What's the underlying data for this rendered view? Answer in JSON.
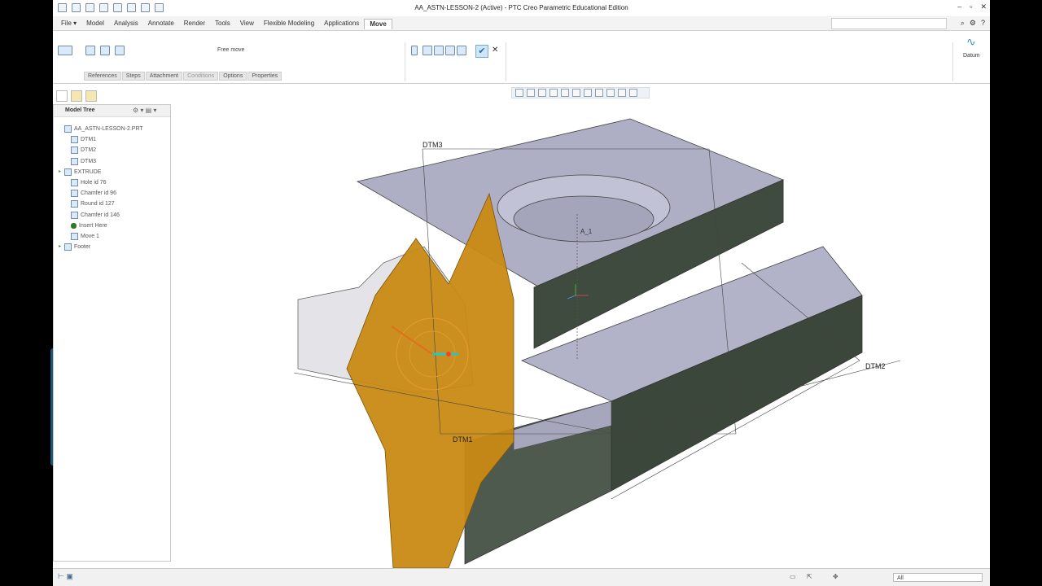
{
  "window": {
    "title": "AA_ASTN-LESSON-2 (Active) - PTC Creo Parametric Educational Edition",
    "controls": [
      "–",
      "▫",
      "✕"
    ]
  },
  "menu": {
    "items": [
      "File",
      "Model",
      "Analysis",
      "Annotate",
      "Render",
      "Tools",
      "View",
      "Flexible Modeling",
      "Applications",
      "Move"
    ],
    "active": "Move",
    "file_arrow": "▾"
  },
  "ribbon": {
    "free_move": "Free move",
    "datum": "Datum",
    "subtabs": [
      "References",
      "Steps",
      "Attachment",
      "Conditions",
      "Options",
      "Properties"
    ],
    "disabled_subtab": "Conditions",
    "ok_glyph": "✔",
    "cancel_glyph": "✕"
  },
  "model_tree": {
    "header": "Model Tree",
    "items": [
      {
        "label": "AA_ASTN-LESSON-2.PRT",
        "toggle": "",
        "icon": "part-icon"
      },
      {
        "label": "DTM1",
        "toggle": "",
        "icon": "datum-plane-icon"
      },
      {
        "label": "DTM2",
        "toggle": "",
        "icon": "datum-plane-icon"
      },
      {
        "label": "DTM3",
        "toggle": "",
        "icon": "datum-plane-icon"
      },
      {
        "label": "EXTRUDE",
        "toggle": "▸",
        "icon": "extrude-icon"
      },
      {
        "label": "Hole id 76",
        "toggle": "",
        "icon": "hole-icon"
      },
      {
        "label": "Chamfer id 96",
        "toggle": "",
        "icon": "chamfer-icon"
      },
      {
        "label": "Round id 127",
        "toggle": "",
        "icon": "round-icon"
      },
      {
        "label": "Chamfer id 146",
        "toggle": "",
        "icon": "chamfer-icon"
      },
      {
        "label": "Insert Here",
        "toggle": "",
        "icon": "insert-here-icon"
      },
      {
        "label": "Move 1",
        "toggle": "",
        "icon": "move-icon"
      },
      {
        "label": "Footer",
        "toggle": "▸",
        "icon": "footer-icon"
      }
    ]
  },
  "viewport": {
    "datum_labels": {
      "dtm3": "DTM3",
      "dtm2": "DTM2",
      "dtm1": "DTM1",
      "axis": "A_1"
    }
  },
  "status": {
    "selection_filter": "All"
  },
  "colors": {
    "plane_orange": "#c98a14",
    "body_top": "#aeaec4",
    "body_side_dark": "#3e4b3e",
    "accent_blue": "#1a6fb8"
  }
}
